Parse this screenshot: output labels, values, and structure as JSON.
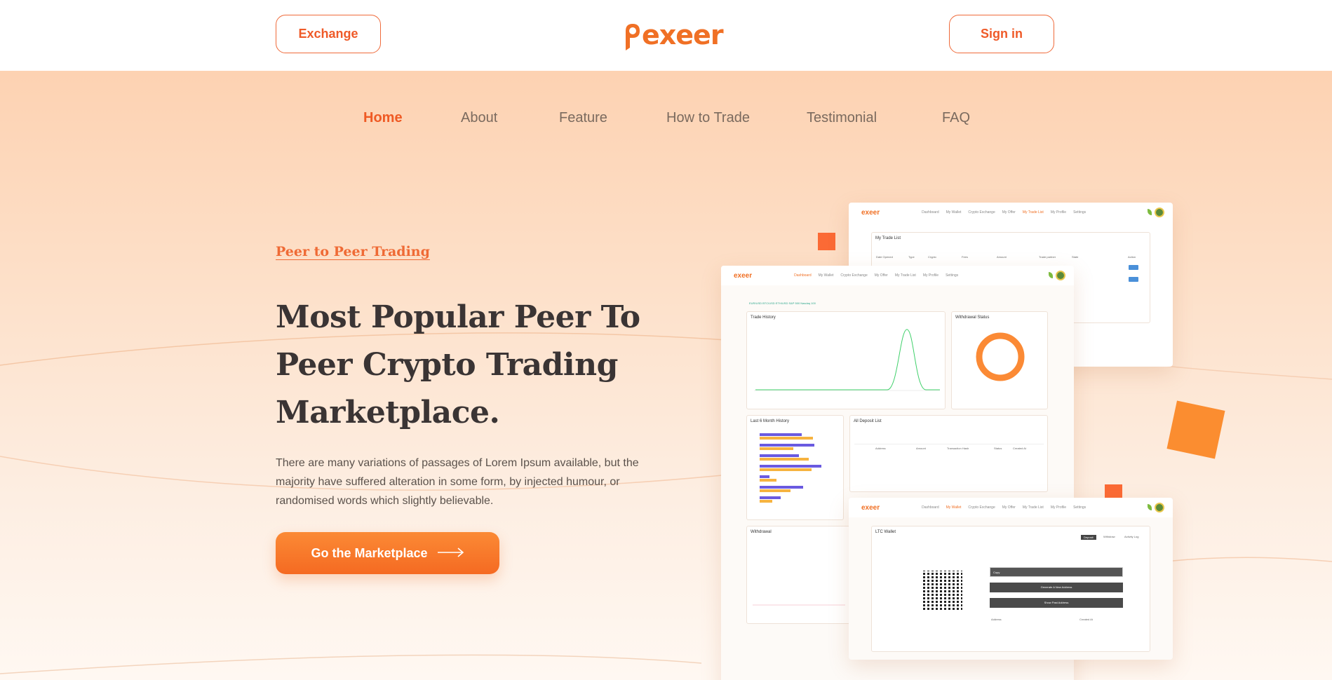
{
  "header": {
    "exchange_label": "Exchange",
    "logo_text": "exeer",
    "signin_label": "Sign in"
  },
  "nav": {
    "items": [
      "Home",
      "About",
      "Feature",
      "How to Trade",
      "Testimonial",
      "FAQ"
    ],
    "active": "Home"
  },
  "hero": {
    "eyebrow": "Peer to Peer Trading",
    "headline": "Most Popular Peer To Peer Crypto Trading Marketplace.",
    "paragraph": "There are many variations of passages of Lorem Ipsum available, but the majority have suffered alteration in some form, by injected humour, or randomised words which slightly believable.",
    "cta_label": "Go the Marketplace",
    "cta_icon": "arrow-right-icon"
  },
  "mockup": {
    "logo": "exeer",
    "trade_list_title": "My Trade List",
    "trade_list_headers": [
      "Date Opened",
      "Type",
      "Crypto",
      "Fees",
      "Amount",
      "Trade partner",
      "State",
      "Action"
    ],
    "nav_top": [
      "Dashboard",
      "My Wallet",
      "Crypto Exchange",
      "My Offer",
      "My Trade List",
      "My Profile",
      "Settings"
    ],
    "ticker": "EUR/USD  BTC/USD  ETH/USD  S&P 500  Nasdaq 100",
    "trade_history_title": "Trade History",
    "withdrawal_status_title": "Withdrawal Status",
    "last6_title": "Last 6 Month History",
    "deposit_list_title": "All Deposit List",
    "deposit_headers": [
      "Address",
      "Amount",
      "Transaction Hash",
      "Status",
      "Created At"
    ],
    "withdrawal_title": "Withdrawal",
    "wallet_title": "LTC Wallet",
    "wallet_tabs": [
      "Deposit",
      "Withdraw",
      "Activity Log"
    ],
    "wallet_buttons": [
      "Copy",
      "Generate A New Address",
      "Show Past Address"
    ],
    "wallet_table_headers": [
      "Address",
      "Created At"
    ]
  },
  "colors": {
    "accent": "#ef5a24",
    "cta_start": "#fb8a35",
    "cta_end": "#f56a22",
    "headline": "#3a3434"
  }
}
